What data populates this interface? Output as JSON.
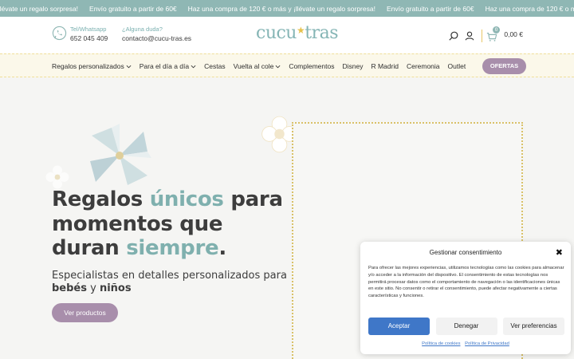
{
  "promo": {
    "items": [
      "más y ¡llévate un regalo sorpresa!",
      "Envío gratuito a partir de 60€",
      "Haz una compra de 120 € o más y ¡llévate un regalo sorpresa!",
      "Envío gratuito a partir de 60€",
      "Haz una compra de 120 € o más y ¡llévate un regalo sorpresa!"
    ]
  },
  "header": {
    "phone_label": "Tel/Whatsapp",
    "phone_value": "652 045 409",
    "help_label": "¿Alguna duda?",
    "help_value": "contacto@cucu-tras.es",
    "logo_left": "cucu",
    "logo_right": "tras",
    "cart_count": "0",
    "cart_total": "0,00 €"
  },
  "nav": {
    "items": [
      {
        "label": "Regalos personalizados",
        "has_dropdown": true
      },
      {
        "label": "Para el día a día",
        "has_dropdown": true
      },
      {
        "label": "Cestas",
        "has_dropdown": false
      },
      {
        "label": "Vuelta al cole",
        "has_dropdown": true
      },
      {
        "label": "Complementos",
        "has_dropdown": false
      },
      {
        "label": "Disney",
        "has_dropdown": false
      },
      {
        "label": "R Madrid",
        "has_dropdown": false
      },
      {
        "label": "Ceremonia",
        "has_dropdown": false
      },
      {
        "label": "Outlet",
        "has_dropdown": false
      }
    ],
    "offers_label": "OFERTAS"
  },
  "hero": {
    "title_part1": "Regalos ",
    "title_accent1": "únicos",
    "title_part2": " para momentos que duran ",
    "title_accent2": "siempre",
    "title_end": ".",
    "sub_part1": "Especialistas en detalles personalizados para ",
    "sub_bold1": "bebés",
    "sub_mid": " y ",
    "sub_bold2": "niños",
    "cta_label": "Ver productos"
  },
  "consent": {
    "title": "Gestionar consentimiento",
    "close_glyph": "✖",
    "text": "Para ofrecer las mejores experiencias, utilizamos tecnologías como las cookies para almacenar y/o acceder a la información del dispositivo. El consentimiento de estas tecnologías nos permitirá procesar datos como el comportamiento de navegación o las identificaciones únicas en este sitio. No consentir o retirar el consentimiento, puede afectar negativamente a ciertas características y funciones.",
    "accept_label": "Aceptar",
    "deny_label": "Denegar",
    "prefs_label": "Ver preferencias",
    "cookies_link": "Política de cookies",
    "privacy_link": "Política de Privacidad"
  },
  "colors": {
    "teal": "#8fb7b4",
    "mauve": "#a88eab",
    "gold": "#e6c24d",
    "consent_blue": "#3f77c8"
  },
  "icons": [
    "whatsapp-icon",
    "search-icon",
    "user-icon",
    "cart-icon",
    "chevron-down-icon",
    "close-icon"
  ]
}
